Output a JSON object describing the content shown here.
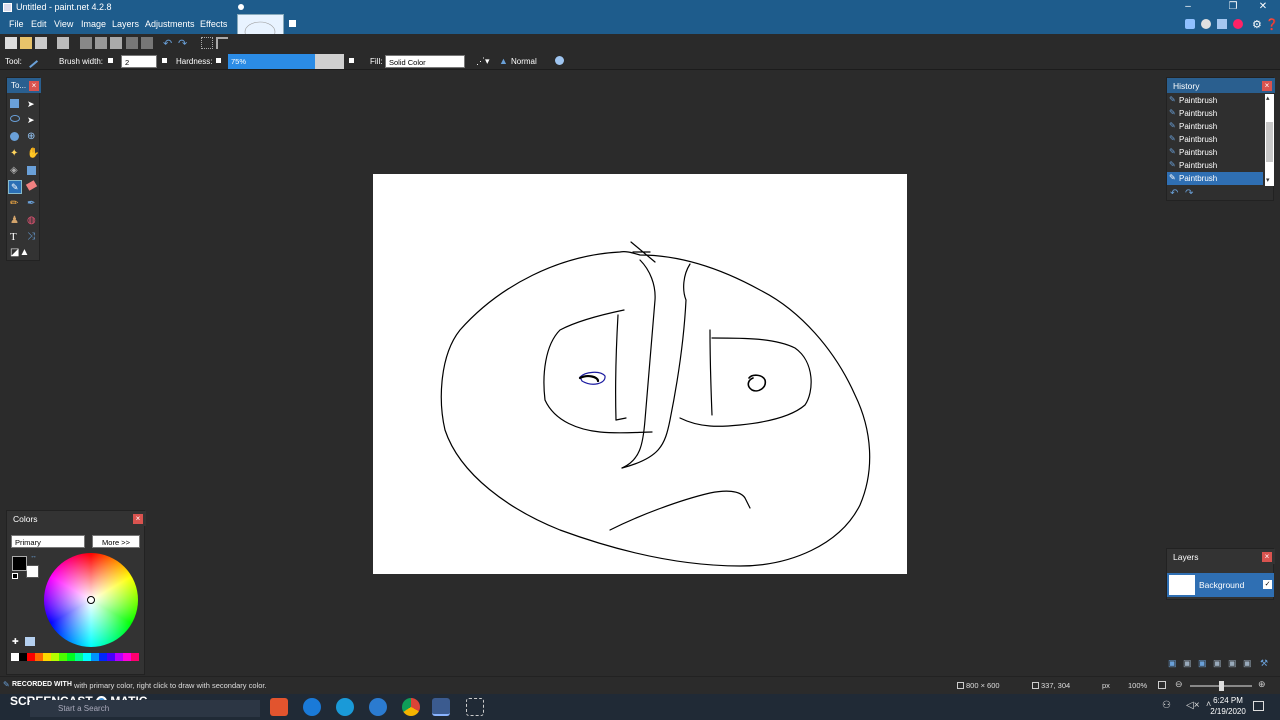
{
  "window": {
    "title": "Untitled - paint.net 4.2.8",
    "controls": [
      "minimize-icon",
      "restore-icon",
      "close-icon"
    ]
  },
  "menu": {
    "items": [
      "File",
      "Edit",
      "View",
      "Image",
      "Layers",
      "Adjustments",
      "Effects"
    ]
  },
  "toolbar": {
    "tool_label": "Tool:",
    "brush_width_label": "Brush width:",
    "brush_width_value": "2",
    "hardness_label": "Hardness:",
    "hardness_value": "75%",
    "hardness_level": 0.75,
    "fill_label": "Fill:",
    "fill_value": "Solid Color",
    "blend_mode": "Normal"
  },
  "tools": {
    "title": "To...",
    "icons": [
      "rectangle-select-icon",
      "move-selection-icon",
      "lasso-icon",
      "move-selected-icon",
      "ellipse-select-icon",
      "zoom-icon",
      "magic-wand-icon",
      "pan-icon",
      "paint-bucket-icon",
      "gradient-icon",
      "paintbrush-icon",
      "eraser-icon",
      "pencil-icon",
      "color-picker-icon",
      "clone-stamp-icon",
      "recolor-icon",
      "text-icon",
      "line-curve-icon",
      "shapes-icon"
    ]
  },
  "history": {
    "title": "History",
    "items": [
      "Paintbrush",
      "Paintbrush",
      "Paintbrush",
      "Paintbrush",
      "Paintbrush",
      "Paintbrush",
      "Paintbrush"
    ],
    "selected_index": 6
  },
  "colors": {
    "title": "Colors",
    "mode": "Primary",
    "more_label": "More >>",
    "primary": "#000000",
    "secondary": "#ffffff",
    "palette": [
      "#ffffff",
      "#000000",
      "#ff0000",
      "#ff6a00",
      "#ffd800",
      "#b6ff00",
      "#4cff00",
      "#00ff21",
      "#00ff90",
      "#00ffff",
      "#0094ff",
      "#0026ff",
      "#4800ff",
      "#b200ff",
      "#ff00dc",
      "#ff006e"
    ]
  },
  "layers": {
    "title": "Layers",
    "items": [
      {
        "name": "Background",
        "visible": true
      }
    ]
  },
  "status": {
    "hint": "with primary color, right click to draw with secondary color.",
    "watermark_left": "RECORDED WITH",
    "watermark_brand_a": "SCREENCAST",
    "watermark_brand_b": "MATIC",
    "image_size": "800 × 600",
    "cursor_pos": "337, 304",
    "units": "px",
    "zoom": "100%"
  },
  "taskbar": {
    "search_placeholder": "Start a Search",
    "time": "6:24 PM",
    "date": "2/19/2020"
  }
}
